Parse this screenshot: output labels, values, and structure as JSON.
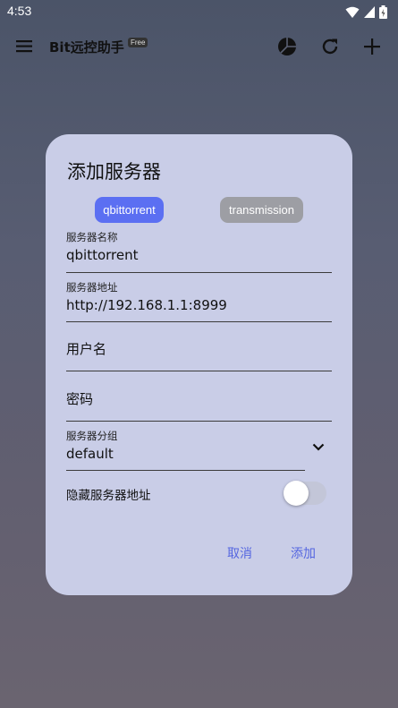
{
  "status_bar": {
    "time": "4:53"
  },
  "appbar": {
    "title": "Bit远控助手",
    "badge": "Free"
  },
  "dialog": {
    "title": "添加服务器",
    "chips": [
      "qbittorrent",
      "transmission"
    ],
    "fields": {
      "server_name": {
        "label": "服务器名称",
        "value": "qbittorrent"
      },
      "server_address": {
        "label": "服务器地址",
        "value": "http://192.168.1.1:8999"
      },
      "username": {
        "placeholder": "用户名"
      },
      "password": {
        "placeholder": "密码"
      },
      "server_group": {
        "label": "服务器分组",
        "value": "default"
      }
    },
    "hide_address": {
      "label": "隐藏服务器地址",
      "enabled": false
    },
    "buttons": {
      "cancel": "取消",
      "add": "添加"
    }
  },
  "colors": {
    "accent": "#5b6ff2",
    "dialog_bg": "#c9cde7",
    "chip_inactive": "#9d9ea4"
  }
}
